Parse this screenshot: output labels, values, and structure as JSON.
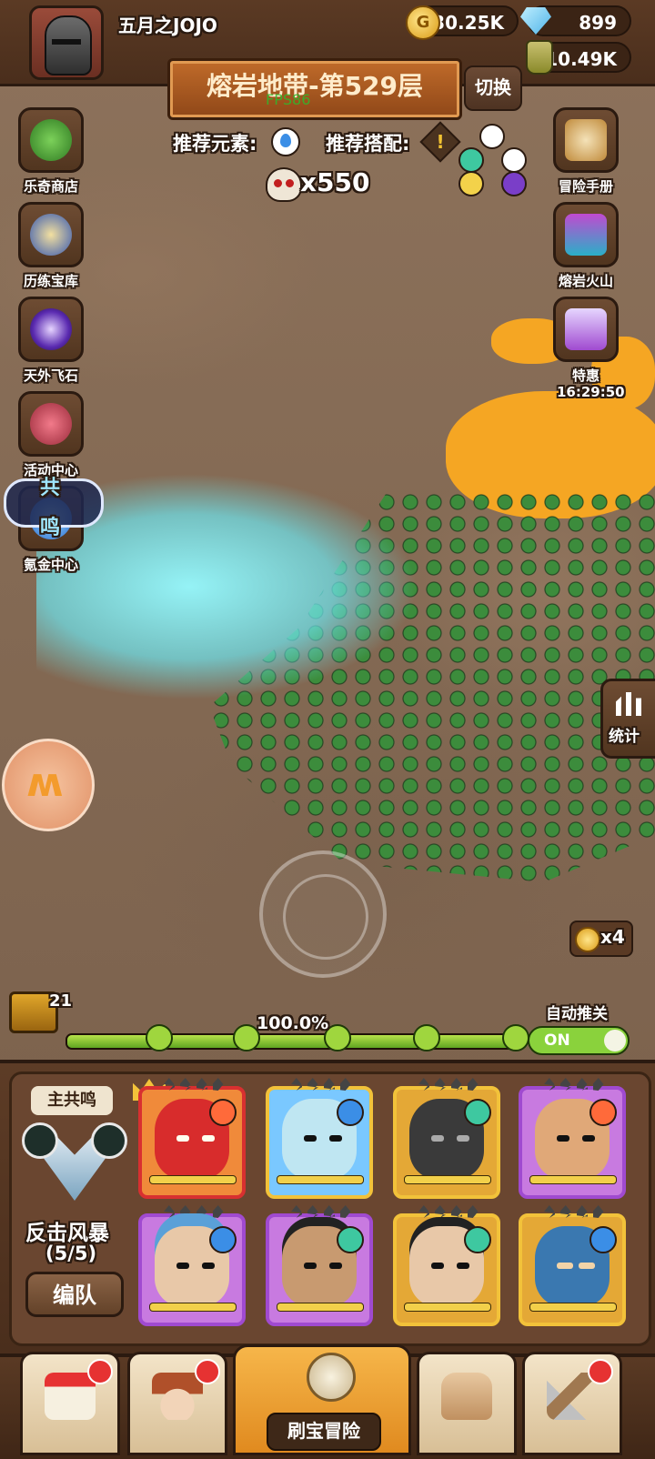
{
  "player": {
    "name": "五月之JOJO",
    "avatar_icon": "knight-helmet-icon"
  },
  "resources": {
    "gold": "730.25K",
    "gems": "899",
    "potion": "10.49K"
  },
  "stage": {
    "title": "熔岩地带-第529层",
    "switch_label": "切换",
    "fps": "FPS86"
  },
  "recommend": {
    "element_label": "推荐元素:",
    "combo_label": "推荐搭配:"
  },
  "kills": "x550",
  "left_menu": [
    {
      "label": "乐奇商店",
      "icon": "clover-icon"
    },
    {
      "label": "历练宝库",
      "icon": "treasure-vault-icon"
    },
    {
      "label": "天外飞石",
      "icon": "galaxy-stone-icon"
    },
    {
      "label": "活动中心",
      "icon": "flower-bouquet-icon"
    },
    {
      "label": "氪金中心",
      "icon": "resonance-icon"
    }
  ],
  "resonance_badge": {
    "line1": "共",
    "line2": "鸣"
  },
  "right_menu": [
    {
      "label": "冒险手册",
      "icon": "scroll-icon"
    },
    {
      "label": "熔岩火山",
      "icon": "volcano-chest-icon"
    },
    {
      "label": "特惠",
      "icon": "gift-chest-icon",
      "timer": "16:29:50"
    }
  ],
  "stats_label": "统计",
  "speed": "x4",
  "progress": {
    "chest_count": "21",
    "percent_label": "100.0%",
    "value": 1.0
  },
  "auto": {
    "label": "自动推关",
    "toggle": "ON"
  },
  "team": {
    "resonance_tag": "主共鸣",
    "resonance_name": "反击风暴",
    "resonance_count": "(5/5)",
    "formation_label": "编队",
    "heroes": [
      {
        "name": "red-demon",
        "element": "fire"
      },
      {
        "name": "ice-king",
        "element": "water"
      },
      {
        "name": "dark-knight",
        "element": "wind"
      },
      {
        "name": "turban-warrior",
        "element": "fire"
      },
      {
        "name": "blue-hair-fighter",
        "element": "water"
      },
      {
        "name": "topknot-warrior",
        "element": "wind"
      },
      {
        "name": "scarred-man",
        "element": "wind"
      },
      {
        "name": "hooded-ninja",
        "element": "water"
      }
    ]
  },
  "bottom_nav": {
    "active_label": "刷宝冒险"
  },
  "colors": {
    "accent": "#e08a1f",
    "frame": "#2b1a10",
    "progress": "#8ad23c",
    "beam": "#9ff5ff",
    "lava": "#f5a623"
  }
}
